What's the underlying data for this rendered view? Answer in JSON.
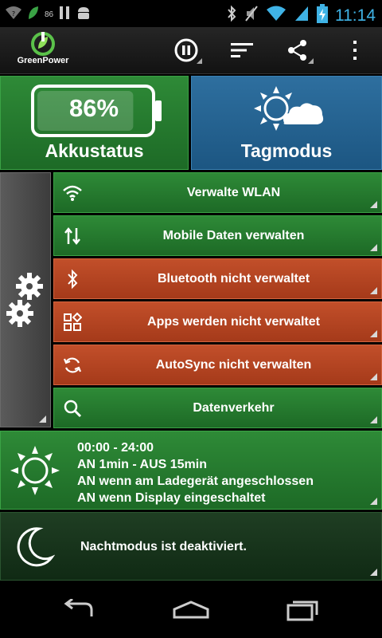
{
  "status_bar": {
    "signal_badge": "86",
    "time": "11:14"
  },
  "action_bar": {
    "app_name": "GreenPower"
  },
  "battery_tile": {
    "percent": "86%",
    "level": 0.86,
    "label": "Akkustatus"
  },
  "mode_tile": {
    "label": "Tagmodus"
  },
  "rows": [
    {
      "label": "Verwalte WLAN",
      "color": "green",
      "icon": "wifi-icon"
    },
    {
      "label": "Mobile Daten verwalten",
      "color": "green",
      "icon": "mobile-data-icon"
    },
    {
      "label": "Bluetooth nicht verwaltet",
      "color": "orange",
      "icon": "bluetooth-icon"
    },
    {
      "label": "Apps werden nicht verwaltet",
      "color": "orange",
      "icon": "apps-icon"
    },
    {
      "label": "AutoSync nicht verwalten",
      "color": "orange",
      "icon": "sync-icon"
    },
    {
      "label": "Datenverkehr",
      "color": "green",
      "icon": "search-icon"
    }
  ],
  "day_schedule": {
    "lines": [
      "00:00 - 24:00",
      "AN 1min - AUS 15min",
      "AN wenn am Ladegerät angeschlossen",
      "AN wenn Display eingeschaltet"
    ]
  },
  "night_mode": {
    "text": "Nachtmodus ist deaktiviert."
  },
  "colors": {
    "green": "#2a7f33",
    "blue": "#2a6a99",
    "orange": "#b8462a",
    "time_accent": "#3fb3e6"
  }
}
